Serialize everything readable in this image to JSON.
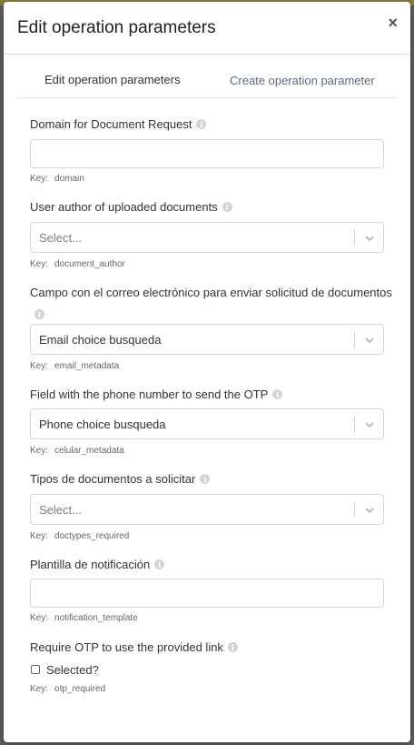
{
  "modal": {
    "title": "Edit operation parameters",
    "close_label": "×"
  },
  "tabs": [
    {
      "label": "Edit operation parameters",
      "active": true
    },
    {
      "label": "Create operation parameter",
      "active": false
    }
  ],
  "key_prefix": "Key:",
  "fields": {
    "domain": {
      "label": "Domain for Document Request",
      "value": "",
      "key": "domain"
    },
    "document_author": {
      "label": "User author of uploaded documents",
      "placeholder": "Select...",
      "key": "document_author"
    },
    "email_metadata": {
      "label": "Campo con el correo electrónico para enviar solicitud de documentos",
      "value": "Email choice busqueda",
      "key": "email_metadata"
    },
    "celular_metadata": {
      "label": "Field with the phone number to send the OTP",
      "value": "Phone choice busqueda",
      "key": "celular_metadata"
    },
    "doctypes_required": {
      "label": "Tipos de documentos a solicitar",
      "placeholder": "Select...",
      "key": "doctypes_required"
    },
    "notification_template": {
      "label": "Plantilla de notificación",
      "value": "",
      "key": "notification_template"
    },
    "otp_required": {
      "label": "Require OTP to use the provided link",
      "checkbox_label": "Selected?",
      "checked": false,
      "key": "otp_required"
    }
  },
  "icons": {
    "info": "info-icon",
    "close": "close-icon",
    "dropdown": "chevron-down-icon"
  },
  "colors": {
    "tab_underline": "#e8e4cf",
    "inactive_tab": "#5f6a7a",
    "border": "#d6d6d6"
  }
}
